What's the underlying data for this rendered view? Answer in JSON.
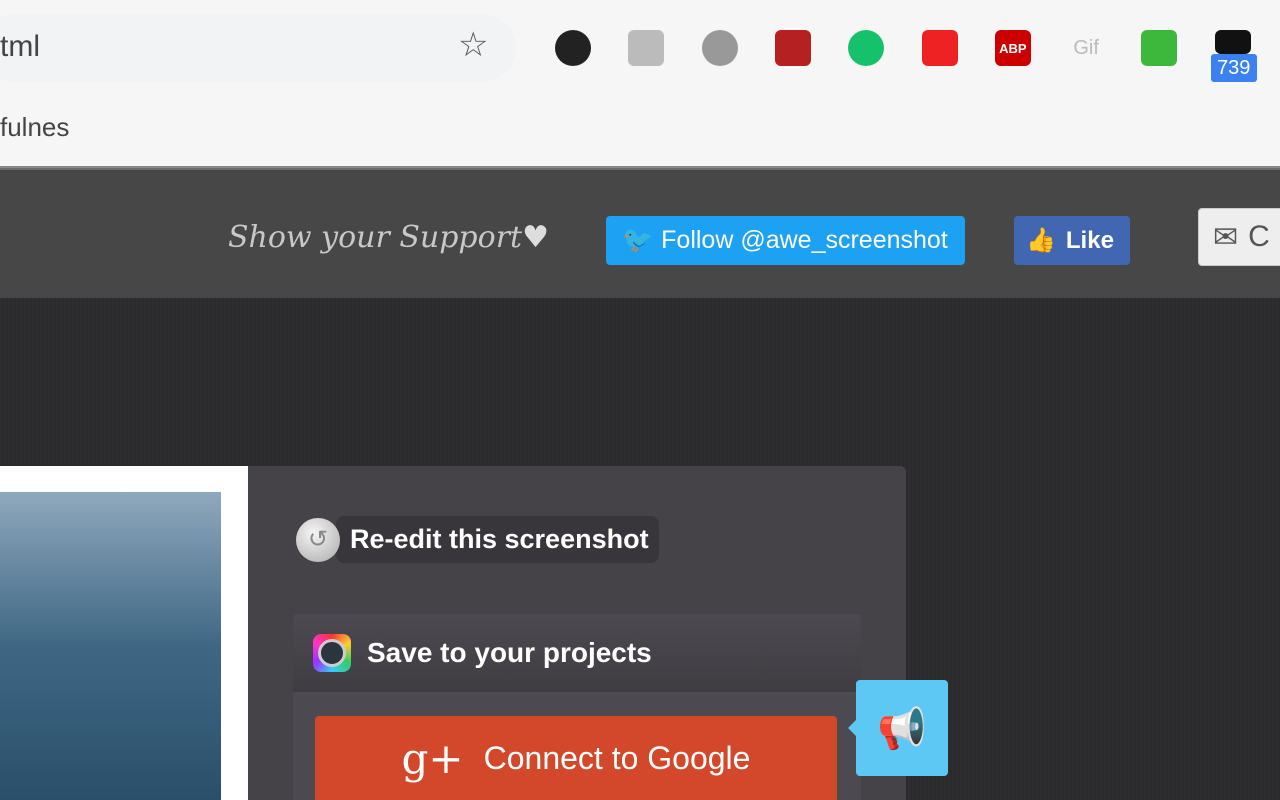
{
  "browser": {
    "address_text": "tml",
    "bookmark_text": "fulnes",
    "extensions": [
      {
        "name": "camera-lens-icon",
        "bg": "#222"
      },
      {
        "name": "notebook-icon",
        "bg": "#bbb"
      },
      {
        "name": "ghost-icon",
        "bg": "#999"
      },
      {
        "name": "fast-forward-icon",
        "bg": "#b52020"
      },
      {
        "name": "grammarly-icon",
        "bg": "#15c26b"
      },
      {
        "name": "stop-hand-icon",
        "bg": "#e22"
      },
      {
        "name": "adblock-plus-icon",
        "bg": "#c00",
        "label": "ABP"
      },
      {
        "name": "gif-icon",
        "bg": "transparent",
        "label": "Gif"
      },
      {
        "name": "robot-icon",
        "bg": "#3db83d"
      },
      {
        "name": "bear-icon",
        "bg": "#111",
        "badge": "739"
      }
    ]
  },
  "header": {
    "support_text": "Show your Support",
    "twitter_label": "Follow @awe_screenshot",
    "facebook_label": "Like",
    "email_label": "C"
  },
  "panel": {
    "reedit_label": "Re-edit this screenshot",
    "save_label": "Save to your projects",
    "google_label": "Connect to Google",
    "google_icon": "g+"
  },
  "colors": {
    "twitter": "#1da1f2",
    "facebook": "#4267b2",
    "google": "#d3472a",
    "megaphone": "#5ec8f5"
  }
}
